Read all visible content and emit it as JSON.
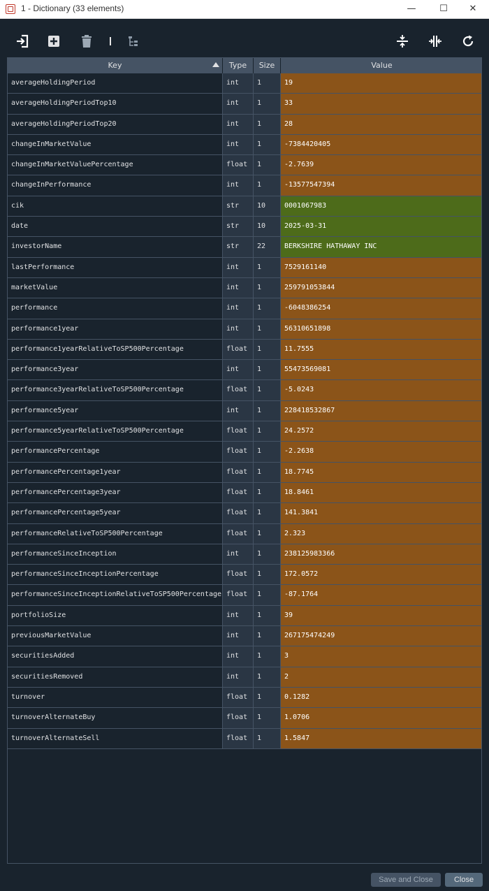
{
  "window": {
    "title": "1 - Dictionary (33 elements)",
    "minimize_glyph": "—",
    "maximize_glyph": "☐",
    "close_glyph": "✕"
  },
  "toolbar": {
    "icons": [
      "import-icon",
      "add-icon",
      "delete-icon",
      "tree-view-icon",
      "collapse-rows-icon",
      "collapse-columns-icon",
      "refresh-icon"
    ]
  },
  "table": {
    "headers": {
      "key": "Key",
      "type": "Type",
      "size": "Size",
      "value": "Value"
    },
    "colors": {
      "int": "#8b5419",
      "float": "#8b5419",
      "str": "#4d6b1a"
    },
    "rows": [
      {
        "key": "averageHoldingPeriod",
        "type": "int",
        "size": "1",
        "value": "19"
      },
      {
        "key": "averageHoldingPeriodTop10",
        "type": "int",
        "size": "1",
        "value": "33"
      },
      {
        "key": "averageHoldingPeriodTop20",
        "type": "int",
        "size": "1",
        "value": "28"
      },
      {
        "key": "changeInMarketValue",
        "type": "int",
        "size": "1",
        "value": "-7384420405"
      },
      {
        "key": "changeInMarketValuePercentage",
        "type": "float",
        "size": "1",
        "value": "-2.7639"
      },
      {
        "key": "changeInPerformance",
        "type": "int",
        "size": "1",
        "value": "-13577547394"
      },
      {
        "key": "cik",
        "type": "str",
        "size": "10",
        "value": "0001067983"
      },
      {
        "key": "date",
        "type": "str",
        "size": "10",
        "value": "2025-03-31"
      },
      {
        "key": "investorName",
        "type": "str",
        "size": "22",
        "value": "BERKSHIRE HATHAWAY INC"
      },
      {
        "key": "lastPerformance",
        "type": "int",
        "size": "1",
        "value": "7529161140"
      },
      {
        "key": "marketValue",
        "type": "int",
        "size": "1",
        "value": "259791053844"
      },
      {
        "key": "performance",
        "type": "int",
        "size": "1",
        "value": "-6048386254"
      },
      {
        "key": "performance1year",
        "type": "int",
        "size": "1",
        "value": "56310651898"
      },
      {
        "key": "performance1yearRelativeToSP500Percentage",
        "type": "float",
        "size": "1",
        "value": "11.7555"
      },
      {
        "key": "performance3year",
        "type": "int",
        "size": "1",
        "value": "55473569081"
      },
      {
        "key": "performance3yearRelativeToSP500Percentage",
        "type": "float",
        "size": "1",
        "value": "-5.0243"
      },
      {
        "key": "performance5year",
        "type": "int",
        "size": "1",
        "value": "228418532867"
      },
      {
        "key": "performance5yearRelativeToSP500Percentage",
        "type": "float",
        "size": "1",
        "value": "24.2572"
      },
      {
        "key": "performancePercentage",
        "type": "float",
        "size": "1",
        "value": "-2.2638"
      },
      {
        "key": "performancePercentage1year",
        "type": "float",
        "size": "1",
        "value": "18.7745"
      },
      {
        "key": "performancePercentage3year",
        "type": "float",
        "size": "1",
        "value": "18.8461"
      },
      {
        "key": "performancePercentage5year",
        "type": "float",
        "size": "1",
        "value": "141.3841"
      },
      {
        "key": "performanceRelativeToSP500Percentage",
        "type": "float",
        "size": "1",
        "value": "2.323"
      },
      {
        "key": "performanceSinceInception",
        "type": "int",
        "size": "1",
        "value": "238125983366"
      },
      {
        "key": "performanceSinceInceptionPercentage",
        "type": "float",
        "size": "1",
        "value": "172.0572"
      },
      {
        "key": "performanceSinceInceptionRelativeToSP500Percentage",
        "type": "float",
        "size": "1",
        "value": "-87.1764"
      },
      {
        "key": "portfolioSize",
        "type": "int",
        "size": "1",
        "value": "39"
      },
      {
        "key": "previousMarketValue",
        "type": "int",
        "size": "1",
        "value": "267175474249"
      },
      {
        "key": "securitiesAdded",
        "type": "int",
        "size": "1",
        "value": "3"
      },
      {
        "key": "securitiesRemoved",
        "type": "int",
        "size": "1",
        "value": "2"
      },
      {
        "key": "turnover",
        "type": "float",
        "size": "1",
        "value": "0.1282"
      },
      {
        "key": "turnoverAlternateBuy",
        "type": "float",
        "size": "1",
        "value": "1.0706"
      },
      {
        "key": "turnoverAlternateSell",
        "type": "float",
        "size": "1",
        "value": "1.5847"
      }
    ]
  },
  "buttons": {
    "save_and_close": "Save and Close",
    "close": "Close"
  }
}
